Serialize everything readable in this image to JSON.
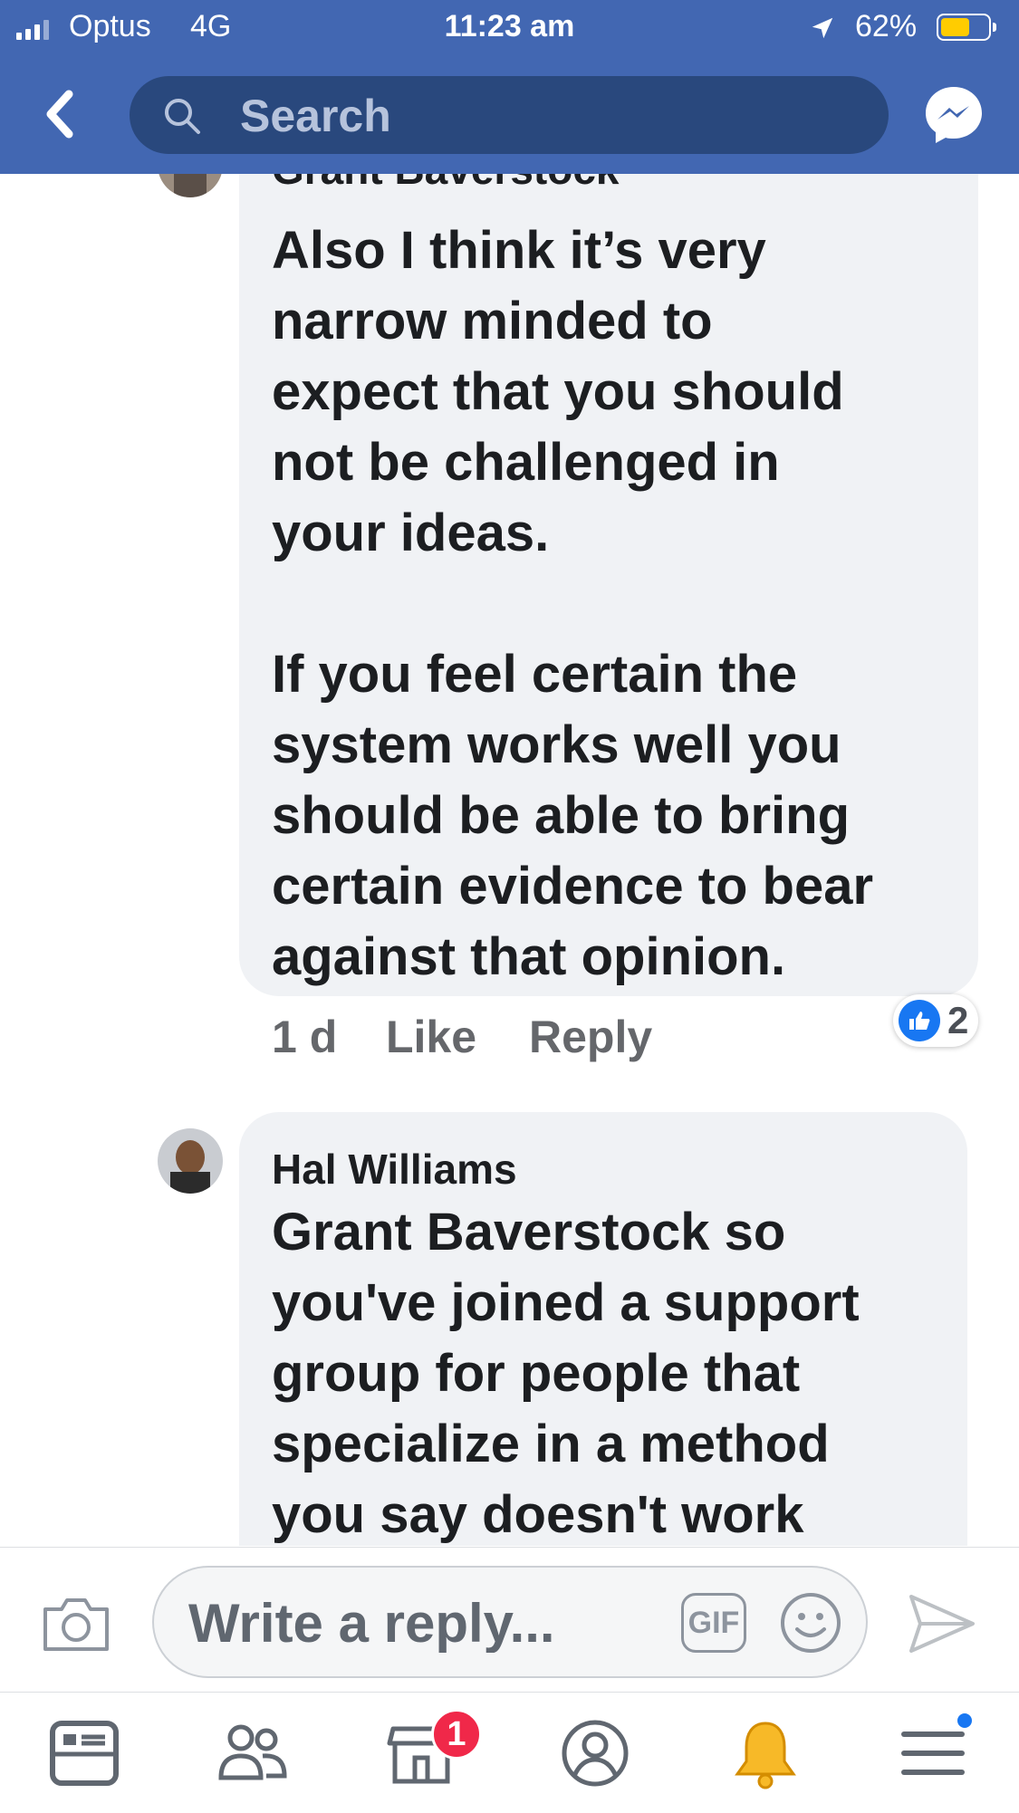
{
  "status_bar": {
    "carrier": "Optus",
    "network": "4G",
    "time": "11:23 am",
    "battery_percent": "62%",
    "battery_level": 0.62,
    "battery_color": "#ffcc00"
  },
  "header": {
    "search_placeholder": "Search",
    "back_icon": "back-chevron-icon",
    "messenger_icon": "messenger-icon",
    "bar_color": "#4267b2"
  },
  "comments": [
    {
      "author": "Grant Baverstock",
      "text": "Also I think it’s very\nnarrow minded to\nexpect that you should\nnot be challenged in\nyour ideas.\n\nIf you feel certain the\nsystem works well you\nshould be able to bring\ncertain evidence to bear\nagainst that opinion.",
      "time": "1 d",
      "like_label": "Like",
      "reply_label": "Reply",
      "reaction_count": "2"
    },
    {
      "author": "Hal Williams",
      "mention": "Grant Baverstock",
      "text": " so\nyou've joined a support\ngroup for people that\nspecialize in a method\nyou say doesn't work"
    }
  ],
  "composer": {
    "placeholder": "Write a reply...",
    "gif_label": "GIF"
  },
  "bottom_nav": {
    "items": [
      "news-feed-icon",
      "friends-icon",
      "marketplace-icon",
      "profile-icon",
      "notifications-bell-icon",
      "menu-icon"
    ],
    "marketplace_badge": "1"
  }
}
